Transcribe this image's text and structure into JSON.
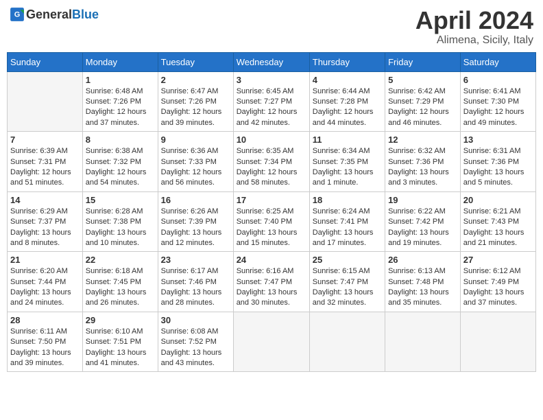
{
  "header": {
    "logo_general": "General",
    "logo_blue": "Blue",
    "month_year": "April 2024",
    "location": "Alimena, Sicily, Italy"
  },
  "days_of_week": [
    "Sunday",
    "Monday",
    "Tuesday",
    "Wednesday",
    "Thursday",
    "Friday",
    "Saturday"
  ],
  "weeks": [
    [
      {
        "day": null,
        "info": null
      },
      {
        "day": "1",
        "sunrise": "6:48 AM",
        "sunset": "7:26 PM",
        "daylight": "12 hours and 37 minutes."
      },
      {
        "day": "2",
        "sunrise": "6:47 AM",
        "sunset": "7:26 PM",
        "daylight": "12 hours and 39 minutes."
      },
      {
        "day": "3",
        "sunrise": "6:45 AM",
        "sunset": "7:27 PM",
        "daylight": "12 hours and 42 minutes."
      },
      {
        "day": "4",
        "sunrise": "6:44 AM",
        "sunset": "7:28 PM",
        "daylight": "12 hours and 44 minutes."
      },
      {
        "day": "5",
        "sunrise": "6:42 AM",
        "sunset": "7:29 PM",
        "daylight": "12 hours and 46 minutes."
      },
      {
        "day": "6",
        "sunrise": "6:41 AM",
        "sunset": "7:30 PM",
        "daylight": "12 hours and 49 minutes."
      }
    ],
    [
      {
        "day": "7",
        "sunrise": "6:39 AM",
        "sunset": "7:31 PM",
        "daylight": "12 hours and 51 minutes."
      },
      {
        "day": "8",
        "sunrise": "6:38 AM",
        "sunset": "7:32 PM",
        "daylight": "12 hours and 54 minutes."
      },
      {
        "day": "9",
        "sunrise": "6:36 AM",
        "sunset": "7:33 PM",
        "daylight": "12 hours and 56 minutes."
      },
      {
        "day": "10",
        "sunrise": "6:35 AM",
        "sunset": "7:34 PM",
        "daylight": "12 hours and 58 minutes."
      },
      {
        "day": "11",
        "sunrise": "6:34 AM",
        "sunset": "7:35 PM",
        "daylight": "13 hours and 1 minute."
      },
      {
        "day": "12",
        "sunrise": "6:32 AM",
        "sunset": "7:36 PM",
        "daylight": "13 hours and 3 minutes."
      },
      {
        "day": "13",
        "sunrise": "6:31 AM",
        "sunset": "7:36 PM",
        "daylight": "13 hours and 5 minutes."
      }
    ],
    [
      {
        "day": "14",
        "sunrise": "6:29 AM",
        "sunset": "7:37 PM",
        "daylight": "13 hours and 8 minutes."
      },
      {
        "day": "15",
        "sunrise": "6:28 AM",
        "sunset": "7:38 PM",
        "daylight": "13 hours and 10 minutes."
      },
      {
        "day": "16",
        "sunrise": "6:26 AM",
        "sunset": "7:39 PM",
        "daylight": "13 hours and 12 minutes."
      },
      {
        "day": "17",
        "sunrise": "6:25 AM",
        "sunset": "7:40 PM",
        "daylight": "13 hours and 15 minutes."
      },
      {
        "day": "18",
        "sunrise": "6:24 AM",
        "sunset": "7:41 PM",
        "daylight": "13 hours and 17 minutes."
      },
      {
        "day": "19",
        "sunrise": "6:22 AM",
        "sunset": "7:42 PM",
        "daylight": "13 hours and 19 minutes."
      },
      {
        "day": "20",
        "sunrise": "6:21 AM",
        "sunset": "7:43 PM",
        "daylight": "13 hours and 21 minutes."
      }
    ],
    [
      {
        "day": "21",
        "sunrise": "6:20 AM",
        "sunset": "7:44 PM",
        "daylight": "13 hours and 24 minutes."
      },
      {
        "day": "22",
        "sunrise": "6:18 AM",
        "sunset": "7:45 PM",
        "daylight": "13 hours and 26 minutes."
      },
      {
        "day": "23",
        "sunrise": "6:17 AM",
        "sunset": "7:46 PM",
        "daylight": "13 hours and 28 minutes."
      },
      {
        "day": "24",
        "sunrise": "6:16 AM",
        "sunset": "7:47 PM",
        "daylight": "13 hours and 30 minutes."
      },
      {
        "day": "25",
        "sunrise": "6:15 AM",
        "sunset": "7:47 PM",
        "daylight": "13 hours and 32 minutes."
      },
      {
        "day": "26",
        "sunrise": "6:13 AM",
        "sunset": "7:48 PM",
        "daylight": "13 hours and 35 minutes."
      },
      {
        "day": "27",
        "sunrise": "6:12 AM",
        "sunset": "7:49 PM",
        "daylight": "13 hours and 37 minutes."
      }
    ],
    [
      {
        "day": "28",
        "sunrise": "6:11 AM",
        "sunset": "7:50 PM",
        "daylight": "13 hours and 39 minutes."
      },
      {
        "day": "29",
        "sunrise": "6:10 AM",
        "sunset": "7:51 PM",
        "daylight": "13 hours and 41 minutes."
      },
      {
        "day": "30",
        "sunrise": "6:08 AM",
        "sunset": "7:52 PM",
        "daylight": "13 hours and 43 minutes."
      },
      {
        "day": null,
        "info": null
      },
      {
        "day": null,
        "info": null
      },
      {
        "day": null,
        "info": null
      },
      {
        "day": null,
        "info": null
      }
    ]
  ],
  "labels": {
    "sunrise": "Sunrise:",
    "sunset": "Sunset:",
    "daylight": "Daylight:"
  }
}
